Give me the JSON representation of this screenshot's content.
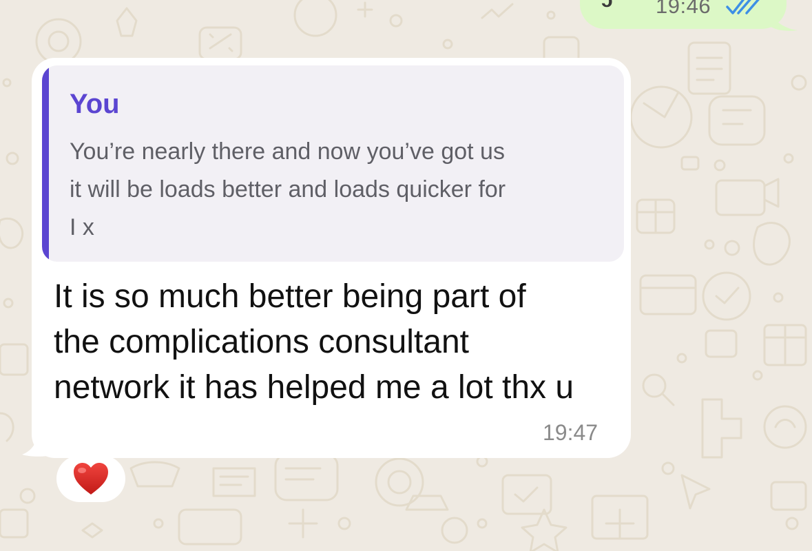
{
  "chat": {
    "outgoing": {
      "status_char": "ɔ",
      "time": "19:46",
      "read_icon": "double-check-icon",
      "colors": {
        "bubble": "#dcf8c6",
        "ticks": "#3d8fe5"
      }
    },
    "incoming": {
      "quoted": {
        "author": "You",
        "lines": [
          "You’re nearly there and now you’ve got us",
          "it will be loads better and loads quicker for",
          "I x"
        ],
        "colors": {
          "bar": "#5b45d1",
          "author": "#5b45d1"
        }
      },
      "message_lines": [
        "It is so much better being part of",
        "the complications consultant",
        "network it has helped me a lot thx u"
      ],
      "time": "19:47",
      "reaction": "❤️",
      "reaction_icon": "heart-icon"
    },
    "background": "#efeae2"
  }
}
